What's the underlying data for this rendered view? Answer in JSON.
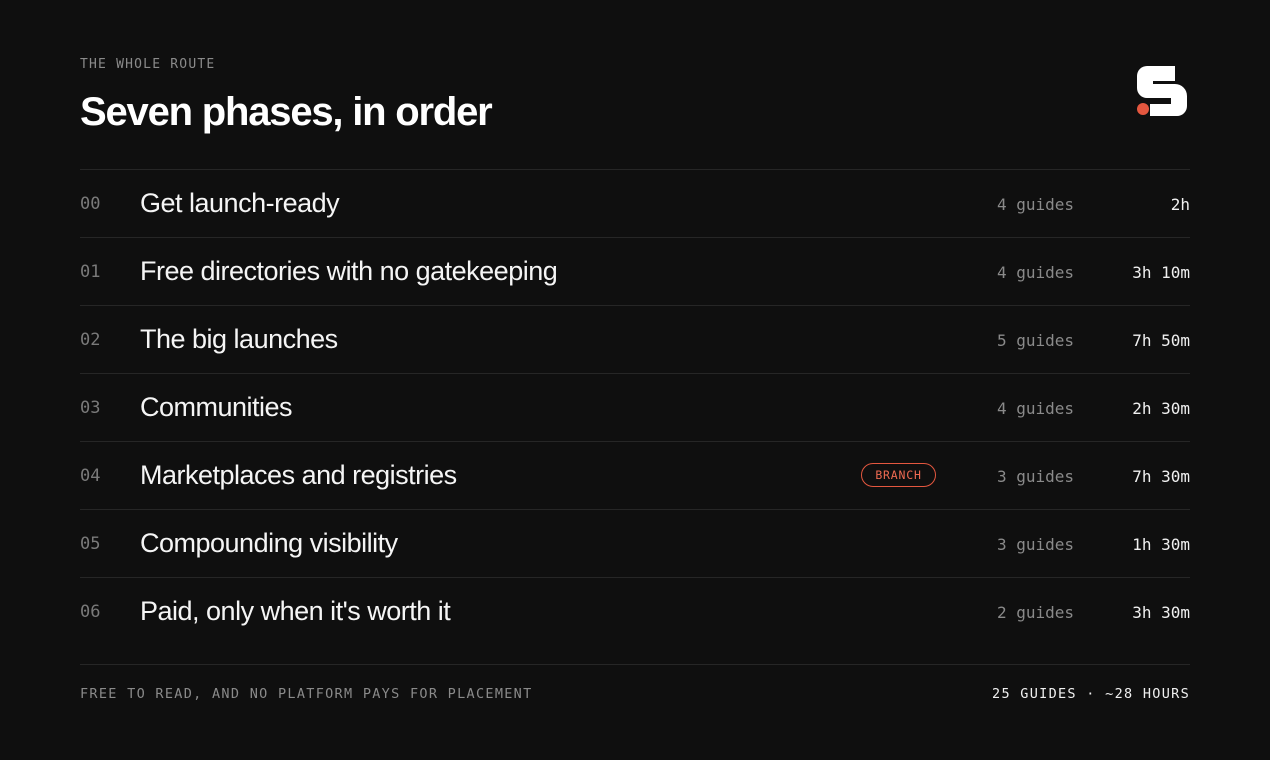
{
  "header": {
    "eyebrow": "THE WHOLE ROUTE",
    "title": "Seven phases, in order",
    "logo_icon": "s-logo-icon",
    "brand_color": "#ffffff",
    "accent_color": "#e4573f"
  },
  "phases": [
    {
      "number": "00",
      "name": "Get launch-ready",
      "guides": "4 guides",
      "time": "2h"
    },
    {
      "number": "01",
      "name": "Free directories with no gatekeeping",
      "guides": "4 guides",
      "time": "3h 10m"
    },
    {
      "number": "02",
      "name": "The big launches",
      "guides": "5 guides",
      "time": "7h 50m"
    },
    {
      "number": "03",
      "name": "Communities",
      "guides": "4 guides",
      "time": "2h 30m"
    },
    {
      "number": "04",
      "name": "Marketplaces and registries",
      "badge": "BRANCH",
      "guides": "3 guides",
      "time": "7h 30m"
    },
    {
      "number": "05",
      "name": "Compounding visibility",
      "guides": "3 guides",
      "time": "1h 30m"
    },
    {
      "number": "06",
      "name": "Paid, only when it's worth it",
      "guides": "2 guides",
      "time": "3h 30m"
    }
  ],
  "footer": {
    "note": "FREE TO READ, AND NO PLATFORM PAYS FOR PLACEMENT",
    "summary": "25 GUIDES · ~28 HOURS"
  }
}
